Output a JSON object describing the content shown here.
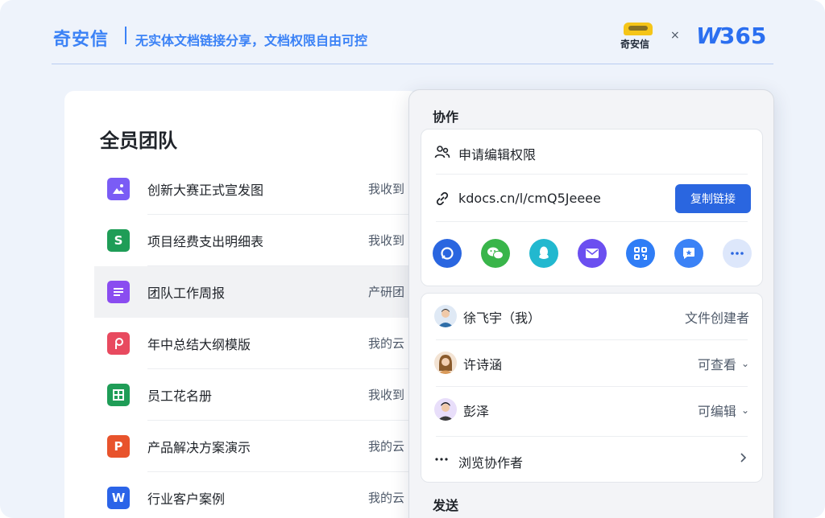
{
  "header": {
    "brand": "奇安信",
    "tagline": "无实体文档链接分享，文档权限自由可控",
    "partner_name": "奇安信",
    "times": "×",
    "wps_logo_w": "W",
    "wps_logo_num": "365"
  },
  "team": {
    "title": "全员团队",
    "files": [
      {
        "icon": "image-file-icon",
        "glyph": "▲",
        "name": "创新大赛正式宣发图",
        "source": "我收到"
      },
      {
        "icon": "spreadsheet-icon",
        "glyph": "S",
        "name": "项目经费支出明细表",
        "source": "我收到"
      },
      {
        "icon": "document-icon",
        "glyph": "≡",
        "name": "团队工作周报",
        "source": "产研团"
      },
      {
        "icon": "pdf-icon",
        "glyph": "P",
        "name": "年中总结大纲模版",
        "source": "我的云"
      },
      {
        "icon": "form-icon",
        "glyph": "⊞",
        "name": "员工花名册",
        "source": "我收到"
      },
      {
        "icon": "presentation-icon",
        "glyph": "P",
        "name": "产品解决方案演示",
        "source": "我的云"
      },
      {
        "icon": "word-icon",
        "glyph": "W",
        "name": "行业客户案例",
        "source": "我的云"
      }
    ]
  },
  "share": {
    "collab_title": "协作",
    "request_edit": "申请编辑权限",
    "link": "kdocs.cn/l/cmQ5Jeeee",
    "copy_button": "复制链接",
    "share_targets": [
      {
        "name": "im-share-icon",
        "color": "#2a66e0"
      },
      {
        "name": "wechat-icon",
        "color": "#39b54a"
      },
      {
        "name": "qq-icon",
        "color": "#22b8cf"
      },
      {
        "name": "email-icon",
        "color": "#6b4ff0"
      },
      {
        "name": "qrcode-icon",
        "color": "#2f7df6"
      },
      {
        "name": "favorite-icon",
        "color": "#3b82f6"
      },
      {
        "name": "more-icon",
        "color": "#dde7fb"
      }
    ],
    "members": [
      {
        "name": "徐飞宇（我）",
        "role": "文件创建者",
        "dropdown": false
      },
      {
        "name": "许诗涵",
        "role": "可查看",
        "dropdown": true
      },
      {
        "name": "彭泽",
        "role": "可编辑",
        "dropdown": true
      }
    ],
    "browse_collaborators": "浏览协作者",
    "send_title": "发送"
  },
  "colors": {
    "accent": "#3b82f6",
    "primary_button": "#2a66e0",
    "background": "#eef3fb"
  }
}
